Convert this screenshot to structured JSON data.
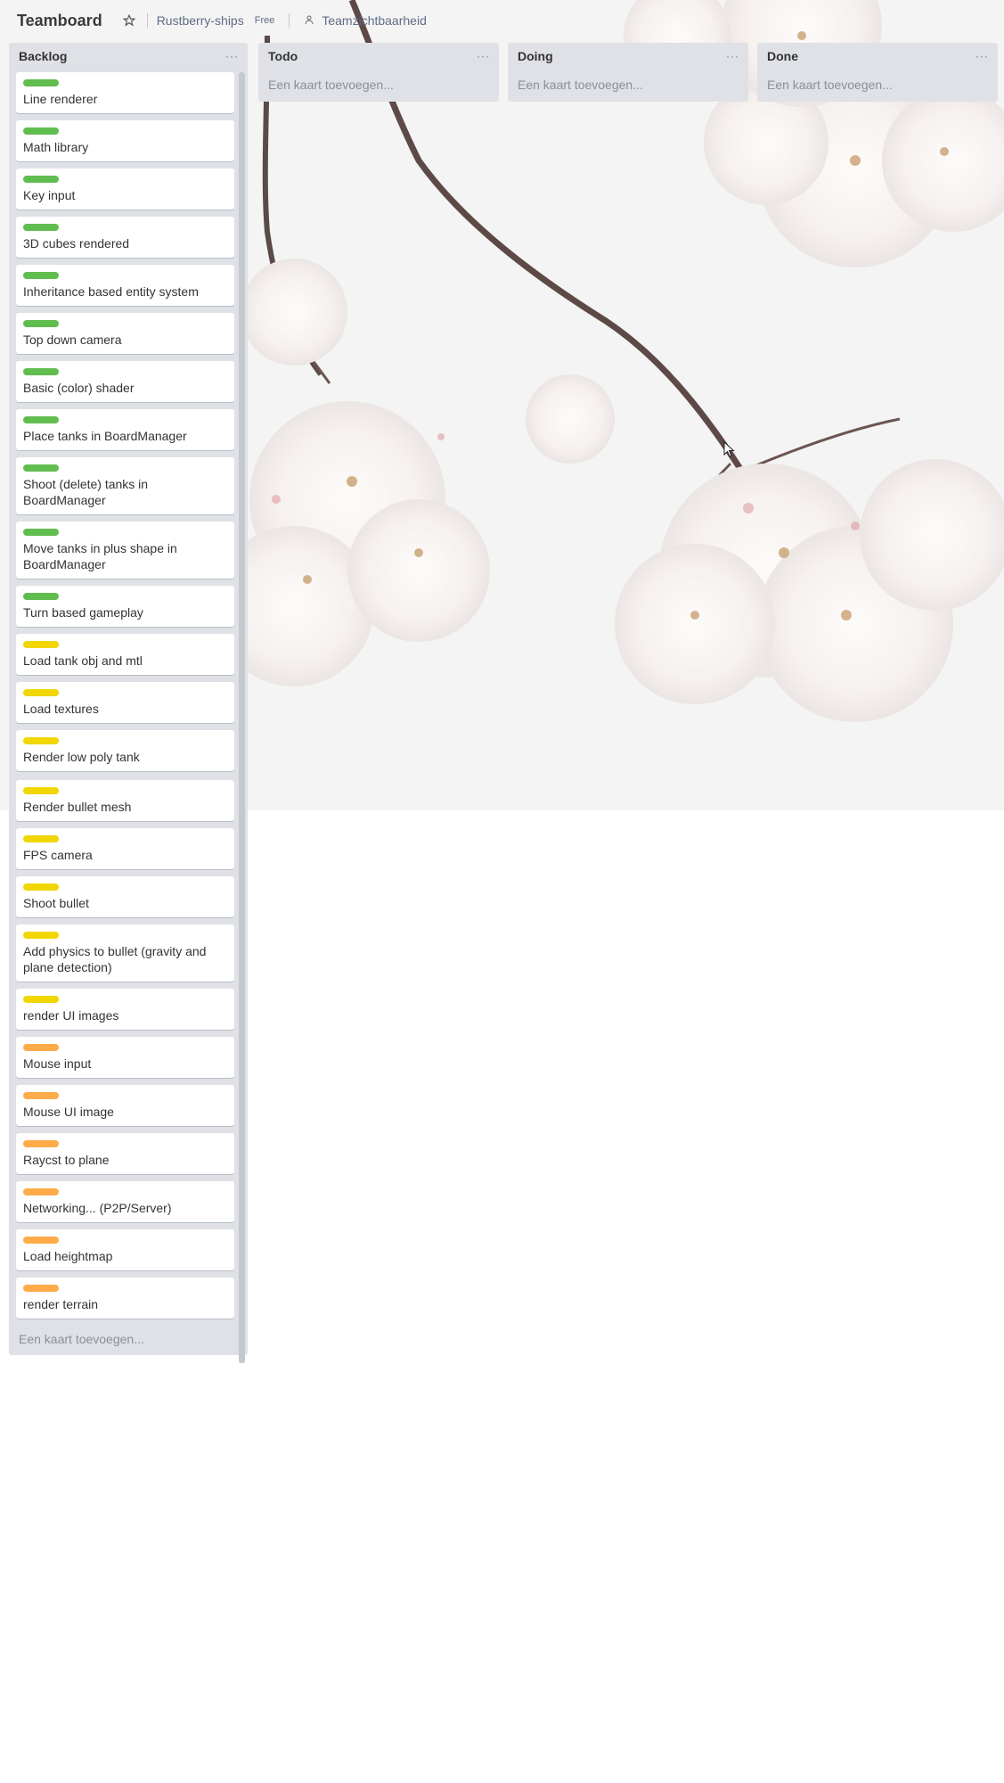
{
  "header": {
    "board_title": "Teamboard",
    "star_icon": "star-icon",
    "team_name": "Rustberry-ships",
    "plan_badge": "Free",
    "visibility_icon": "team-icon",
    "visibility_label": "Teamzichtbaarheid"
  },
  "colors": {
    "green": "#61bd4f",
    "yellow": "#f2d600",
    "orange": "#ffab4a",
    "list_bg": "#dfe1e6",
    "card_bg": "#ffffff"
  },
  "lists": [
    {
      "title": "Backlog",
      "menu": "···",
      "add_card": "Een kaart toevoegen...",
      "cards": [
        {
          "title": "Line renderer",
          "label": "green"
        },
        {
          "title": "Math library",
          "label": "green"
        },
        {
          "title": "Key input",
          "label": "green"
        },
        {
          "title": "3D cubes rendered",
          "label": "green"
        },
        {
          "title": "Inheritance based entity system",
          "label": "green"
        },
        {
          "title": "Top down camera",
          "label": "green"
        },
        {
          "title": "Basic (color) shader",
          "label": "green"
        },
        {
          "title": "Place tanks in BoardManager",
          "label": "green"
        },
        {
          "title": "Shoot (delete) tanks in BoardManager",
          "label": "green"
        },
        {
          "title": "Move tanks in plus shape in BoardManager",
          "label": "green"
        },
        {
          "title": "Turn based gameplay",
          "label": "green"
        },
        {
          "title": "Load tank obj and mtl",
          "label": "yellow"
        },
        {
          "title": "Load textures",
          "label": "yellow"
        },
        {
          "title": "Render low poly tank",
          "label": "yellow"
        },
        {
          "title": "Render bullet mesh",
          "label": "yellow"
        },
        {
          "title": "FPS camera",
          "label": "yellow"
        },
        {
          "title": "Shoot bullet",
          "label": "yellow"
        },
        {
          "title": "Add physics to bullet (gravity and plane detection)",
          "label": "yellow"
        },
        {
          "title": "render UI images",
          "label": "yellow"
        },
        {
          "title": "Mouse input",
          "label": "orange"
        },
        {
          "title": "Mouse UI image",
          "label": "orange"
        },
        {
          "title": "Raycst to plane",
          "label": "orange"
        },
        {
          "title": "Networking... (P2P/Server)",
          "label": "orange"
        },
        {
          "title": "Load heightmap",
          "label": "orange"
        },
        {
          "title": "render terrain",
          "label": "orange"
        }
      ]
    },
    {
      "title": "Todo",
      "menu": "···",
      "add_card": "Een kaart toevoegen...",
      "cards": []
    },
    {
      "title": "Doing",
      "menu": "···",
      "add_card": "Een kaart toevoegen...",
      "cards": []
    },
    {
      "title": "Done",
      "menu": "···",
      "add_card": "Een kaart toevoegen...",
      "cards": []
    }
  ]
}
